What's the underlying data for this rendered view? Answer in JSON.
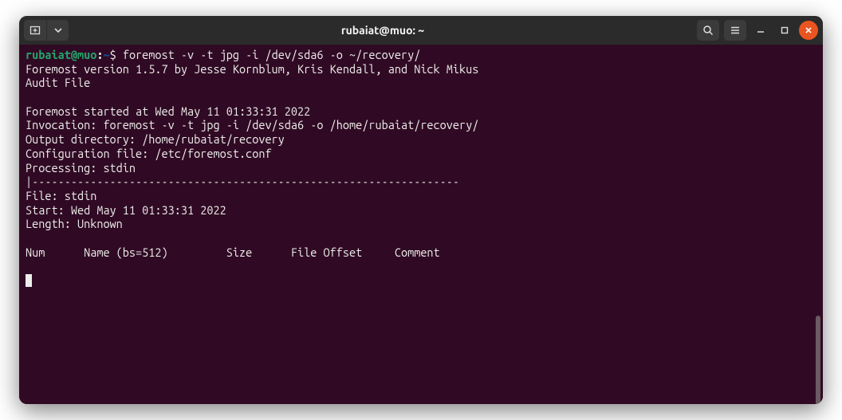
{
  "titlebar": {
    "title": "rubaiat@muo: ~"
  },
  "prompt": {
    "user_host": "rubaiat@muo",
    "colon": ":",
    "path": "~",
    "dollar": "$"
  },
  "command": " foremost -v -t jpg -i /dev/sda6 -o ~/recovery/",
  "output": {
    "l1": "Foremost version 1.5.7 by Jesse Kornblum, Kris Kendall, and Nick Mikus",
    "l2": "Audit File",
    "l3": "",
    "l4": "Foremost started at Wed May 11 01:33:31 2022",
    "l5": "Invocation: foremost -v -t jpg -i /dev/sda6 -o /home/rubaiat/recovery/",
    "l6": "Output directory: /home/rubaiat/recovery",
    "l7": "Configuration file: /etc/foremost.conf",
    "l8": "Processing: stdin",
    "l9": "|------------------------------------------------------------------",
    "l10": "File: stdin",
    "l11": "Start: Wed May 11 01:33:31 2022",
    "l12": "Length: Unknown",
    "l13": " ",
    "l14": "Num      Name (bs=512)         Size      File Offset     Comment ",
    "l15": ""
  }
}
